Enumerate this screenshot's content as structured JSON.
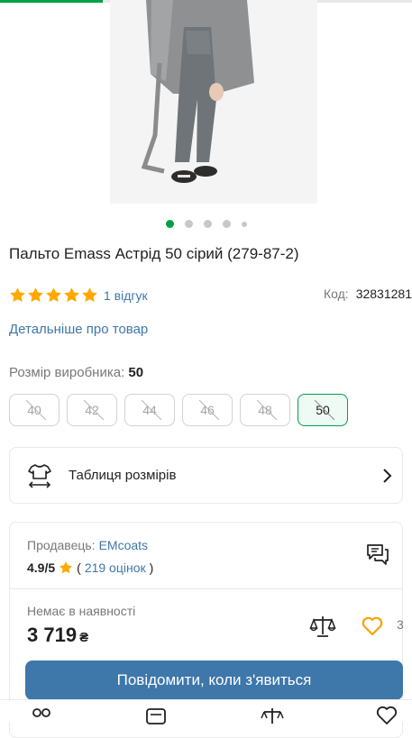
{
  "gallery": {
    "slide_count": 5,
    "active_index": 0,
    "progress": 0.25
  },
  "product": {
    "title": "Пальто Emass Астрід 50 сірий (279-87-2)",
    "rating": 5,
    "reviews_label": "1 відгук",
    "code_label": "Код:",
    "code_value": "32831281",
    "details_link": "Детальніше про товар"
  },
  "size_selector": {
    "label": "Розмір виробника:",
    "selected": "50",
    "options": [
      {
        "label": "40",
        "available": false,
        "selected": false
      },
      {
        "label": "42",
        "available": false,
        "selected": false
      },
      {
        "label": "44",
        "available": false,
        "selected": false
      },
      {
        "label": "46",
        "available": false,
        "selected": false
      },
      {
        "label": "48",
        "available": false,
        "selected": false
      },
      {
        "label": "50",
        "available": false,
        "selected": true
      }
    ]
  },
  "size_table": {
    "label": "Таблиця розмірів",
    "icon": "tshirt-size-icon"
  },
  "seller": {
    "prefix": "Продавець:",
    "name": "EMcoats",
    "score": "4.9/5",
    "open_paren": "(",
    "count": "219 оцінок",
    "close_paren": ")"
  },
  "offer": {
    "stock_status": "Немає в наявності",
    "price": "3 719",
    "currency": "₴",
    "wishlist_count": "3",
    "notify_button": "Повідомити, коли з'явиться"
  },
  "colors": {
    "accent_green": "#00a046",
    "link_blue": "#3e77aa",
    "star_yellow": "#ffa900",
    "heart_orange": "#f8a300"
  },
  "bottom_nav": {
    "items": [
      "catalog-icon",
      "list-icon",
      "compare-icon",
      "heart-icon"
    ]
  }
}
